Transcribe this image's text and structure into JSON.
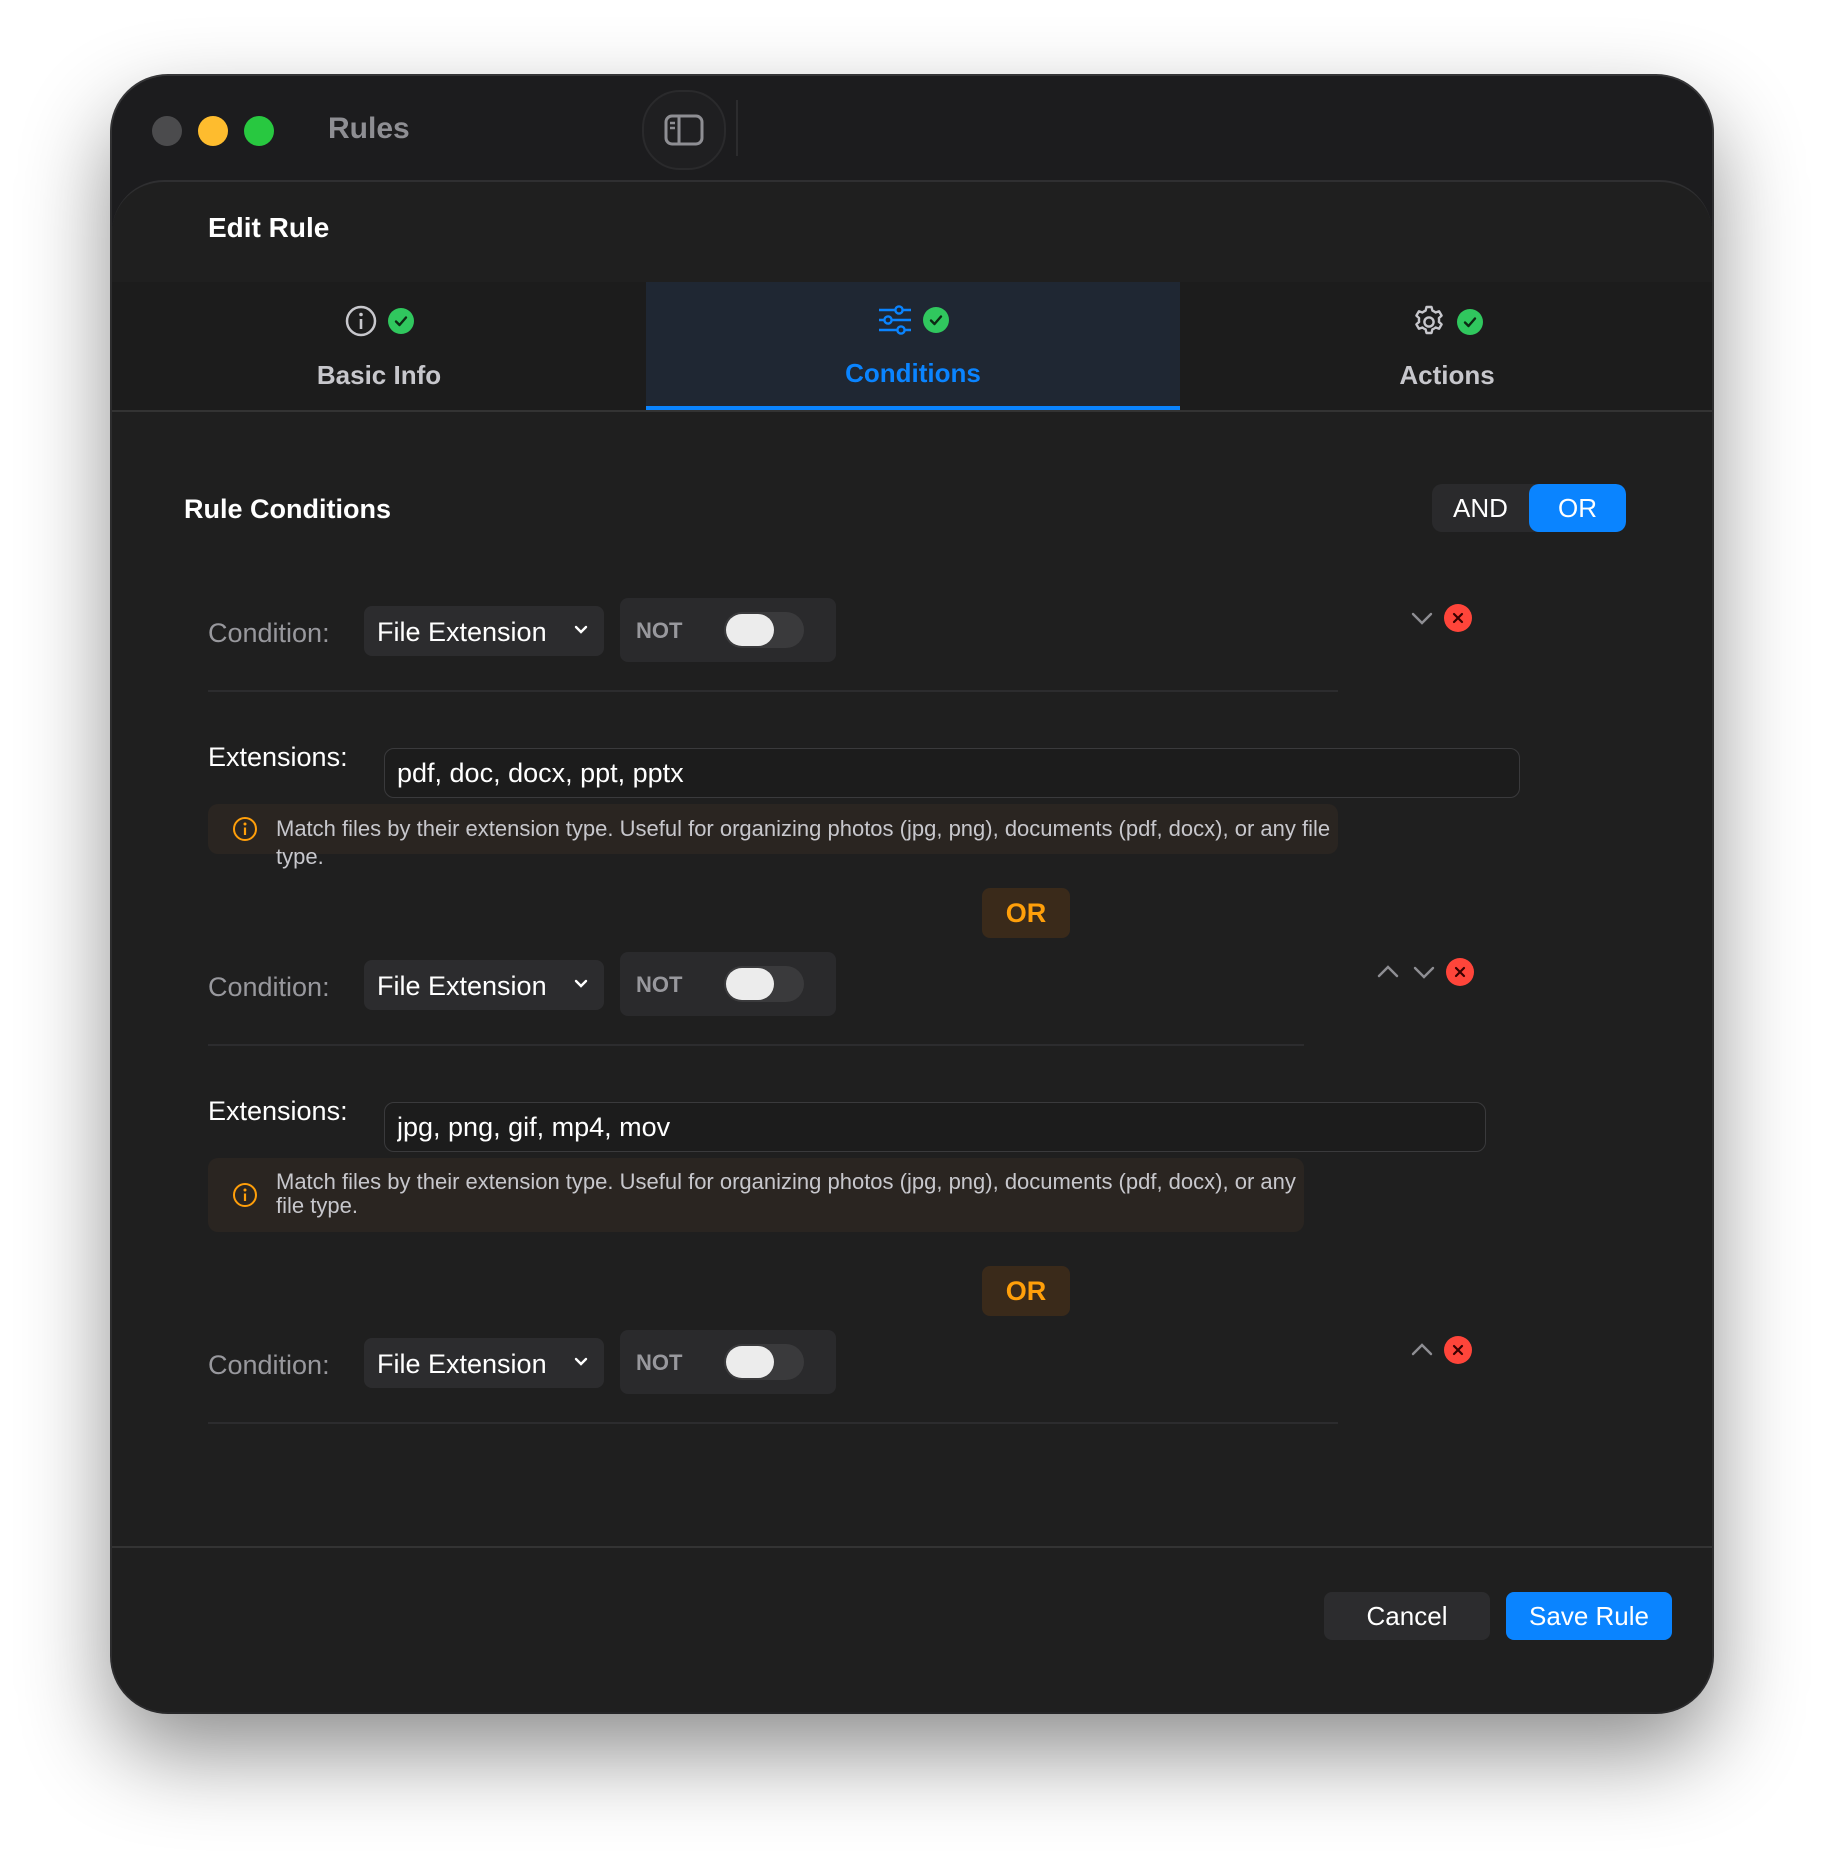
{
  "window": {
    "title": "Rules",
    "traffic_lights": [
      "close",
      "minimize",
      "maximize"
    ]
  },
  "sheet": {
    "title": "Edit Rule",
    "tabs": [
      {
        "label": "Basic Info",
        "icon": "info-icon",
        "status": "complete"
      },
      {
        "label": "Conditions",
        "icon": "sliders-icon",
        "status": "complete",
        "active": true
      },
      {
        "label": "Actions",
        "icon": "gear-icon",
        "status": "complete"
      }
    ]
  },
  "conditions": {
    "title": "Rule Conditions",
    "logic": {
      "options": [
        "AND",
        "OR"
      ],
      "selected": "OR"
    },
    "items": [
      {
        "label": "Condition:",
        "type": "File Extension",
        "not_label": "NOT",
        "not_enabled": false,
        "extensions_label": "Extensions:",
        "extensions_value": "pdf, doc, docx, ppt, pptx",
        "info_text": "Match files by their extension type. Useful for organizing photos (jpg, png), documents (pdf, docx), or any file type."
      },
      {
        "label": "Condition:",
        "type": "File Extension",
        "not_label": "NOT",
        "not_enabled": false,
        "extensions_label": "Extensions:",
        "extensions_value": "jpg, png, gif, mp4, mov",
        "info_text_line1": "Match files by their extension type. Useful for organizing photos (jpg, png), documents (pdf, docx), or any",
        "info_text_line2": "file type."
      },
      {
        "label": "Condition:",
        "type": "File Extension",
        "not_label": "NOT",
        "not_enabled": false
      }
    ],
    "joiner": "OR"
  },
  "footer": {
    "cancel": "Cancel",
    "save": "Save Rule"
  },
  "colors": {
    "accent": "#0a84ff",
    "success": "#30c75e",
    "danger": "#ff453a",
    "joiner": "#ff9f0a"
  }
}
